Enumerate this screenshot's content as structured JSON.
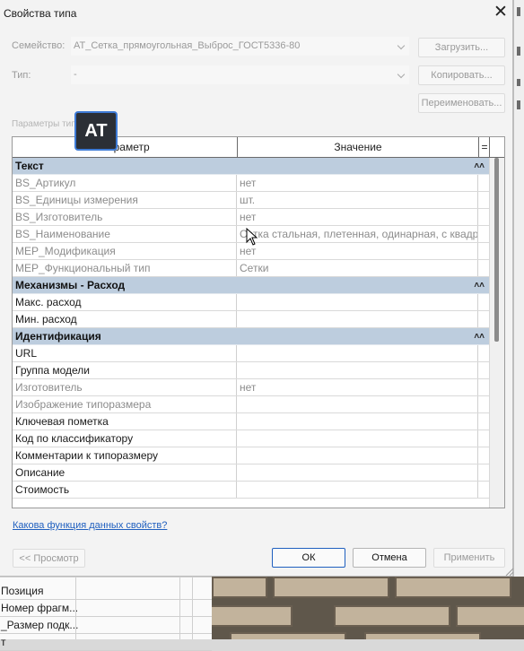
{
  "dialog": {
    "title": "Свойства типа",
    "family_label": "Семейство:",
    "family_value": "AT_Сетка_прямоугольная_Выброс_ГОСТ5336-80",
    "type_label": "Тип:",
    "type_value": "-",
    "load_button": "Загрузить...",
    "copy_button": "Копировать...",
    "rename_button": "Переименовать...",
    "params_label": "Параметры типа",
    "help_link": "Какова функция данных свойств?",
    "preview_button": "<< Просмотр",
    "ok_button": "ОК",
    "cancel_button": "Отмена",
    "apply_button": "Применить"
  },
  "table": {
    "col_param": "Параметр",
    "col_value": "Значение",
    "col_eq": "="
  },
  "groups": {
    "text": {
      "title": "Текст",
      "rows": [
        {
          "param": "BS_Артикул",
          "value": "нет"
        },
        {
          "param": "BS_Единицы измерения",
          "value": "шт."
        },
        {
          "param": "BS_Изготовитель",
          "value": "нет"
        },
        {
          "param": "BS_Наименование",
          "value": "Сетка стальная, плетенная, одинарная, с квадр"
        },
        {
          "param": "MEP_Модификация",
          "value": "нет"
        },
        {
          "param": "MEP_Функциональный тип",
          "value": "Сетки"
        }
      ]
    },
    "mech": {
      "title": "Механизмы - Расход",
      "rows": [
        {
          "param": "Макс. расход",
          "value": ""
        },
        {
          "param": "Мин. расход",
          "value": ""
        }
      ]
    },
    "ident": {
      "title": "Идентификация",
      "rows": [
        {
          "param": "URL",
          "value": ""
        },
        {
          "param": "Группа модели",
          "value": ""
        },
        {
          "param": "Изготовитель",
          "value": "нет"
        },
        {
          "param": "Изображение типоразмера",
          "value": ""
        },
        {
          "param": "Ключевая пометка",
          "value": ""
        },
        {
          "param": "Код по классификатору",
          "value": ""
        },
        {
          "param": "Комментарии к типоразмеру",
          "value": ""
        },
        {
          "param": "Описание",
          "value": ""
        },
        {
          "param": "Стоимость",
          "value": ""
        }
      ]
    }
  },
  "background": {
    "rows": [
      "Позиция",
      "Номер фрагм...",
      "_Размер подк...",
      "т"
    ]
  },
  "overlay": {
    "badge": "AT"
  }
}
